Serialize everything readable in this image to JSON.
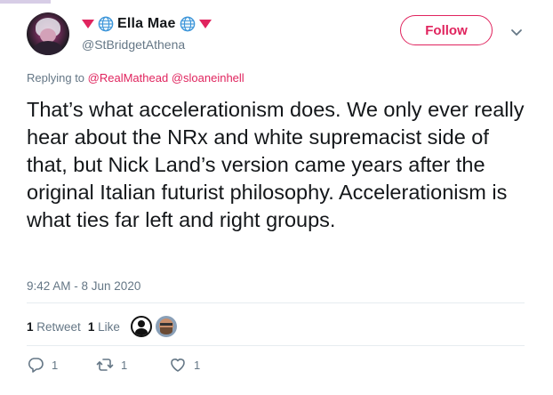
{
  "tweet": {
    "author": {
      "display_name": "Ella Mae",
      "handle": "@StBridgetAthena",
      "name_decorations": [
        "down-triangle-icon",
        "globe-icon",
        "globe-icon",
        "down-triangle-icon"
      ]
    },
    "follow_label": "Follow",
    "reply": {
      "prefix": "Replying to",
      "mentions": [
        "@RealMathead",
        "@sloaneinhell"
      ]
    },
    "text": "That’s what accelerationism does. We only ever really hear about the NRx and white supremacist side of that, but Nick Land’s version came years after the original Italian futurist philosophy. Accelerationism is what ties far left and right groups.",
    "timestamp": "9:42 AM - 8 Jun 2020",
    "stats": {
      "retweets_count": "1",
      "retweets_label": "Retweet",
      "likes_count": "1",
      "likes_label": "Like"
    },
    "actions": {
      "reply_count": "1",
      "retweet_count": "1",
      "like_count": "1"
    }
  },
  "colors": {
    "accent": "#e0245e",
    "secondary_text": "#657786",
    "primary_text": "#14171a",
    "divider": "#e6ecf0"
  }
}
